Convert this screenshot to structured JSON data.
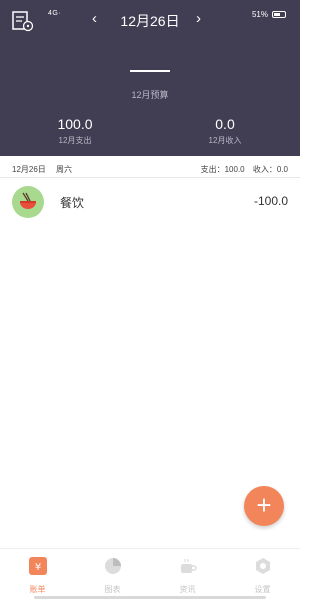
{
  "status_bar": {
    "left": "4G·",
    "battery": "51%"
  },
  "header": {
    "nav_prev": "‹",
    "date": "12月26日",
    "nav_next": "›",
    "budget_label": "12月预算",
    "expense_value": "100.0",
    "expense_label": "12月支出",
    "income_value": "0.0",
    "income_label": "12月收入"
  },
  "day_summary": {
    "date": "12月26日",
    "weekday": "周六",
    "expense": "支出：100.0",
    "income": "收入：0.0"
  },
  "records": [
    {
      "category": "餐饮",
      "amount": "-100.0",
      "icon": "bowl-icon",
      "color": "#a8d98f"
    }
  ],
  "fab_label": "+",
  "tabs": [
    {
      "label": "账单",
      "icon": "yen-icon",
      "active": true
    },
    {
      "label": "图表",
      "icon": "pie-chart-icon",
      "active": false
    },
    {
      "label": "资讯",
      "icon": "coffee-icon",
      "active": false
    },
    {
      "label": "设置",
      "icon": "settings-icon",
      "active": false
    }
  ],
  "colors": {
    "header_bg": "#413d52",
    "accent": "#f2855a",
    "category_green": "#a8d98f"
  }
}
